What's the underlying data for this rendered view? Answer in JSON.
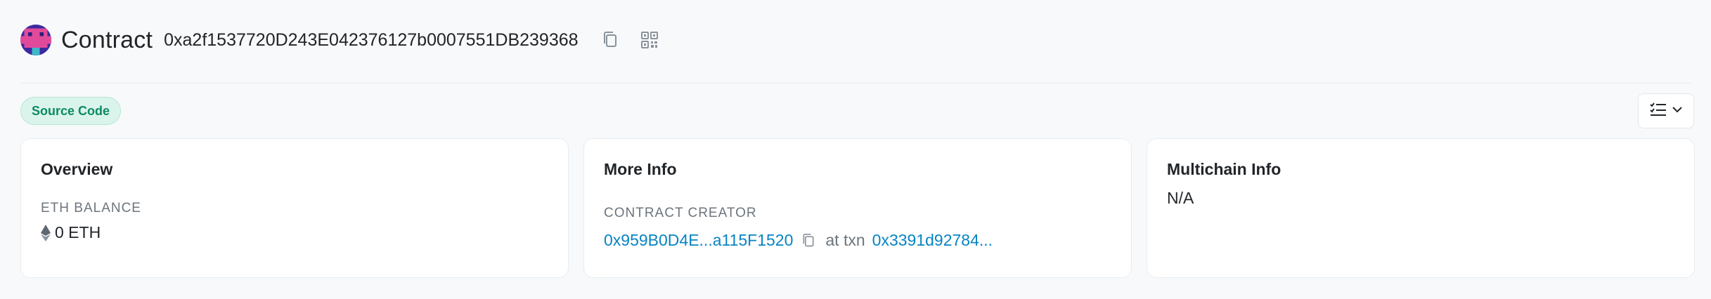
{
  "header": {
    "title": "Contract",
    "address": "0xa2f1537720D243E042376127b0007551DB239368"
  },
  "badge": {
    "label": "Source Code"
  },
  "cards": {
    "overview": {
      "title": "Overview",
      "balance_label": "ETH BALANCE",
      "balance_value": "0 ETH"
    },
    "more_info": {
      "title": "More Info",
      "creator_label": "CONTRACT CREATOR",
      "creator_address": "0x959B0D4E...a115F1520",
      "at_txn_text": "at txn",
      "txn_hash": "0x3391d92784..."
    },
    "multichain": {
      "title": "Multichain Info",
      "value": "N/A"
    }
  },
  "colors": {
    "link": "#0784c3",
    "badge_bg": "#daf4ec",
    "badge_text": "#0d8a63",
    "background": "#f8f9fa"
  },
  "icons": {
    "copy": "copy-icon",
    "qr": "qr-code-icon",
    "view": "list-check-icon",
    "eth": "ethereum-icon"
  }
}
